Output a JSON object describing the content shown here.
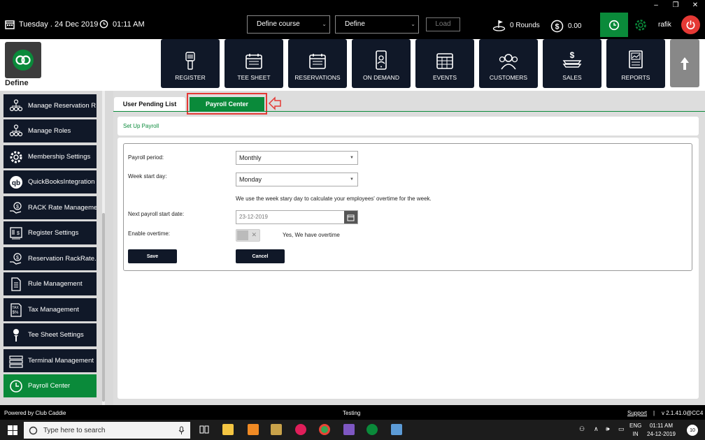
{
  "window_controls": {
    "minimize": "‒",
    "restore": "❐",
    "close": "✕"
  },
  "header": {
    "date": "Tuesday . 24 Dec 2019",
    "time": "01:11 AM",
    "course_select": "Define  course",
    "define_select": "Define",
    "load_label": "Load",
    "rounds": "0 Rounds",
    "amount": "0.00",
    "username": "rafik"
  },
  "logo_label": "Define",
  "nav": [
    {
      "label": "REGISTER",
      "icon": "barcode-scanner-icon"
    },
    {
      "label": "TEE SHEET",
      "icon": "calendar-icon"
    },
    {
      "label": "RESERVATIONS",
      "icon": "calendar-icon"
    },
    {
      "label": "ON DEMAND",
      "icon": "mobile-icon"
    },
    {
      "label": "EVENTS",
      "icon": "calendar-grid-icon"
    },
    {
      "label": "CUSTOMERS",
      "icon": "users-icon"
    },
    {
      "label": "SALES",
      "icon": "money-icon"
    },
    {
      "label": "REPORTS",
      "icon": "report-icon"
    }
  ],
  "sidebar": {
    "items": [
      {
        "label": "Manage Reservation R...",
        "icon": "org-chart-icon"
      },
      {
        "label": "Manage Roles",
        "icon": "org-chart-icon"
      },
      {
        "label": "Membership Settings",
        "icon": "gear-icon"
      },
      {
        "label": "QuickBooksIntegration",
        "icon": "quickbooks-icon"
      },
      {
        "label": "RACK Rate Manageme...",
        "icon": "rack-rate-icon"
      },
      {
        "label": "Register Settings",
        "icon": "register-icon"
      },
      {
        "label": "Reservation RackRate...",
        "icon": "rack-rate-icon"
      },
      {
        "label": "Rule Management",
        "icon": "document-icon"
      },
      {
        "label": "Tax Management",
        "icon": "tax-icon"
      },
      {
        "label": "Tee Sheet Settings",
        "icon": "golf-tee-icon"
      },
      {
        "label": "Terminal Management",
        "icon": "terminal-icon"
      },
      {
        "label": "Payroll Center",
        "icon": "clock-icon"
      }
    ]
  },
  "tabs": {
    "pending": "User Pending List",
    "payroll": "Payroll Center"
  },
  "setup_title": "Set Up Payroll",
  "form": {
    "payroll_period_label": "Payroll period:",
    "payroll_period_value": "Monthly",
    "week_start_label": "Week start day:",
    "week_start_value": "Monday",
    "week_hint": "We use the week stary day to calculate your employees' overtime for the week.",
    "next_start_label": "Next payroll start date:",
    "next_start_value": "23-12-2019",
    "overtime_label": "Enable overtime:",
    "overtime_text": "Yes, We have overtime",
    "save_label": "Save",
    "cancel_label": "Cancel"
  },
  "status": {
    "powered": "Powered by Club Caddie",
    "center": "Testing",
    "support": "Support",
    "separator": "|",
    "version": "v 2.1.41.0@CC4"
  },
  "taskbar": {
    "search_placeholder": "Type here to search",
    "lang_line1": "ENG",
    "lang_line2": "IN",
    "clock_time": "01:11 AM",
    "clock_date": "24-12-2019",
    "notif_count": "10"
  },
  "colors": {
    "accent": "#0a8a3a",
    "dark": "#101828",
    "alert": "#e53935"
  }
}
